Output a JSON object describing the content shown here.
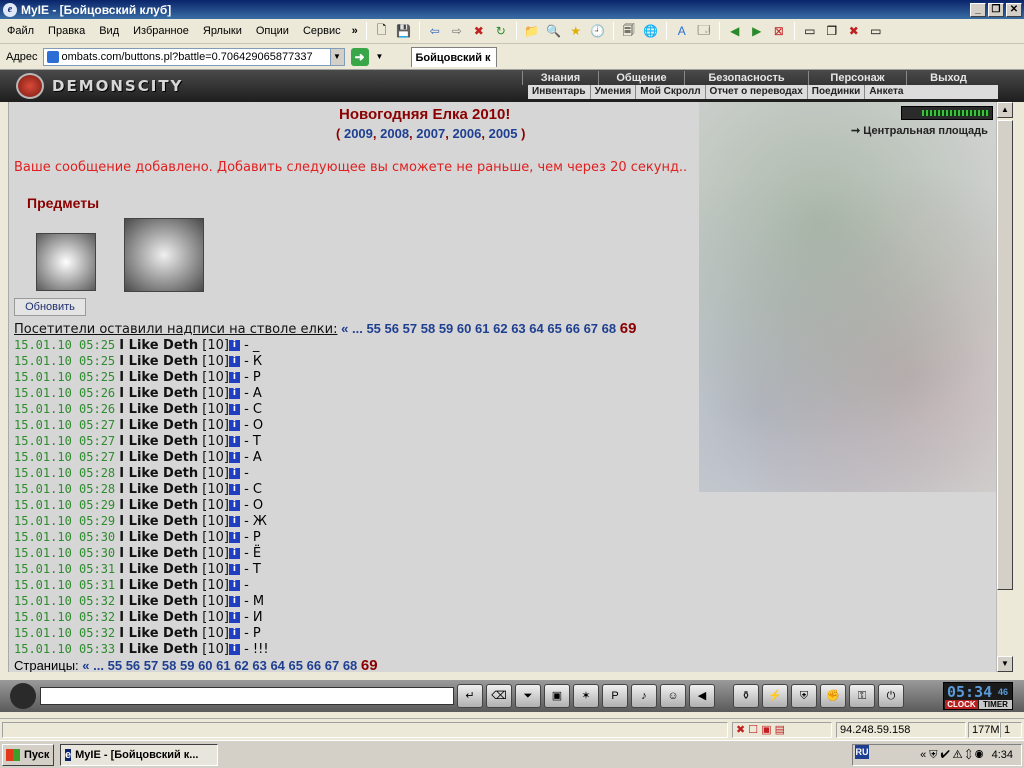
{
  "window": {
    "title": "MyIE - [Бойцовский клуб]"
  },
  "menu": {
    "items": [
      "Файл",
      "Правка",
      "Вид",
      "Избранное",
      "Ярлыки",
      "Опции",
      "Сервис"
    ],
    "more": "»"
  },
  "address": {
    "label": "Адрес",
    "url": "ombats.com/buttons.pl?battle=0.706429065877337",
    "tab": "Бойцовский к"
  },
  "game": {
    "logo": "DEMONSCITY",
    "top_nav": [
      "Знания",
      "Общение",
      "Безопасность",
      "Персонаж",
      "Выход"
    ],
    "sub_nav": [
      "Инвентарь",
      "Умения",
      "Мой Скролл",
      "Отчет о переводах",
      "Поединки",
      "Анкета"
    ]
  },
  "page": {
    "title": "Новогодняя Елка 2010!",
    "years_open": "(",
    "years": [
      "2009",
      "2008",
      "2007",
      "2006",
      "2005"
    ],
    "years_close": ")",
    "central_link": "Центральная площадь",
    "message": "Ваше сообщение добавлено. Добавить следующее вы сможете не раньше, чем через 20 секунд..",
    "items_title": "Предметы",
    "refresh_label": "Обновить",
    "visitors_label": "Посетители оставили надписи на стволе елки:",
    "pages_label": "Страницы:",
    "pager_prev": "« ...",
    "pager_pages": [
      "55",
      "56",
      "57",
      "58",
      "59",
      "60",
      "61",
      "62",
      "63",
      "64",
      "65",
      "66",
      "67",
      "68"
    ],
    "pager_current": "69"
  },
  "log": [
    {
      "ts": "15.01.10 05:25",
      "nick": "I Like Deth",
      "lvl": "[10]",
      "msg": "- _"
    },
    {
      "ts": "15.01.10 05:25",
      "nick": "I Like Deth",
      "lvl": "[10]",
      "msg": "- К"
    },
    {
      "ts": "15.01.10 05:25",
      "nick": "I Like Deth",
      "lvl": "[10]",
      "msg": "- Р"
    },
    {
      "ts": "15.01.10 05:26",
      "nick": "I Like Deth",
      "lvl": "[10]",
      "msg": "- А"
    },
    {
      "ts": "15.01.10 05:26",
      "nick": "I Like Deth",
      "lvl": "[10]",
      "msg": "- С"
    },
    {
      "ts": "15.01.10 05:27",
      "nick": "I Like Deth",
      "lvl": "[10]",
      "msg": "- О"
    },
    {
      "ts": "15.01.10 05:27",
      "nick": "I Like Deth",
      "lvl": "[10]",
      "msg": "- Т"
    },
    {
      "ts": "15.01.10 05:27",
      "nick": "I Like Deth",
      "lvl": "[10]",
      "msg": "- А"
    },
    {
      "ts": "15.01.10 05:28",
      "nick": "I Like Deth",
      "lvl": "[10]",
      "msg": "-"
    },
    {
      "ts": "15.01.10 05:28",
      "nick": "I Like Deth",
      "lvl": "[10]",
      "msg": "- С"
    },
    {
      "ts": "15.01.10 05:29",
      "nick": "I Like Deth",
      "lvl": "[10]",
      "msg": "- О"
    },
    {
      "ts": "15.01.10 05:29",
      "nick": "I Like Deth",
      "lvl": "[10]",
      "msg": "- Ж"
    },
    {
      "ts": "15.01.10 05:30",
      "nick": "I Like Deth",
      "lvl": "[10]",
      "msg": "- Р"
    },
    {
      "ts": "15.01.10 05:30",
      "nick": "I Like Deth",
      "lvl": "[10]",
      "msg": "- Ё"
    },
    {
      "ts": "15.01.10 05:31",
      "nick": "I Like Deth",
      "lvl": "[10]",
      "msg": "- Т"
    },
    {
      "ts": "15.01.10 05:31",
      "nick": "I Like Deth",
      "lvl": "[10]",
      "msg": "-"
    },
    {
      "ts": "15.01.10 05:32",
      "nick": "I Like Deth",
      "lvl": "[10]",
      "msg": "- М"
    },
    {
      "ts": "15.01.10 05:32",
      "nick": "I Like Deth",
      "lvl": "[10]",
      "msg": "- И"
    },
    {
      "ts": "15.01.10 05:32",
      "nick": "I Like Deth",
      "lvl": "[10]",
      "msg": "- Р"
    },
    {
      "ts": "15.01.10 05:33",
      "nick": "I Like Deth",
      "lvl": "[10]",
      "msg": "- !!!"
    }
  ],
  "clock": {
    "time": "05:34",
    "seconds": "46",
    "clock_label": "CLOCK",
    "timer_label": "TIMER"
  },
  "status": {
    "ip": "94.248.59.158",
    "memory": "177M",
    "count": "1"
  },
  "taskbar": {
    "start": "Пуск",
    "task": "MyIE - [Бойцовский к...",
    "lang": "RU",
    "time": "4:34"
  },
  "colors": {
    "accent_red": "#8b0000",
    "link_blue": "#1f3f91",
    "timestamp_green": "#2e8b2e",
    "message_red": "#e01f1f"
  }
}
